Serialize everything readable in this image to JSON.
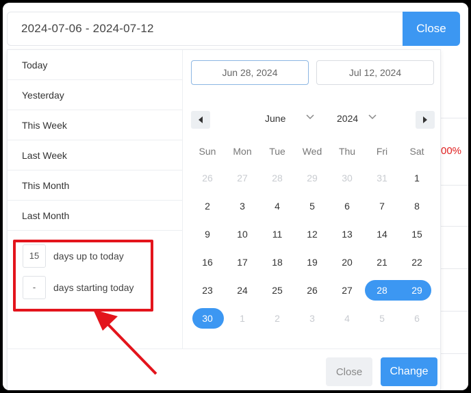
{
  "range_input": {
    "value": "2024-07-06 - 2024-07-12"
  },
  "top_close_label": "Close",
  "background": {
    "fragment_text": "00%"
  },
  "presets": [
    {
      "label": "Today"
    },
    {
      "label": "Yesterday"
    },
    {
      "label": "This Week"
    },
    {
      "label": "Last Week"
    },
    {
      "label": "This Month"
    },
    {
      "label": "Last Month"
    }
  ],
  "custom": {
    "up_to_today_value": "15",
    "up_to_today_label": "days up to today",
    "starting_today_value": "-",
    "starting_today_label": "days starting today"
  },
  "calendar": {
    "start_date": "Jun 28, 2024",
    "end_date": "Jul 12, 2024",
    "month": "June",
    "year": "2024",
    "weekdays": [
      "Sun",
      "Mon",
      "Tue",
      "Wed",
      "Thu",
      "Fri",
      "Sat"
    ],
    "weeks": [
      [
        "26",
        "27",
        "28",
        "29",
        "30",
        "31",
        "1"
      ],
      [
        "2",
        "3",
        "4",
        "5",
        "6",
        "7",
        "8"
      ],
      [
        "9",
        "10",
        "11",
        "12",
        "13",
        "14",
        "15"
      ],
      [
        "16",
        "17",
        "18",
        "19",
        "20",
        "21",
        "22"
      ],
      [
        "23",
        "24",
        "25",
        "26",
        "27",
        "28",
        "29"
      ],
      [
        "30",
        "1",
        "2",
        "3",
        "4",
        "5",
        "6"
      ]
    ]
  },
  "footer": {
    "close_label": "Close",
    "change_label": "Change"
  },
  "colors": {
    "accent": "#3c97f2",
    "highlight": "#e3141c"
  },
  "icons": [
    "chevron-left-icon",
    "chevron-right-icon",
    "chevron-down-icon",
    "red-arrow-annotation"
  ]
}
